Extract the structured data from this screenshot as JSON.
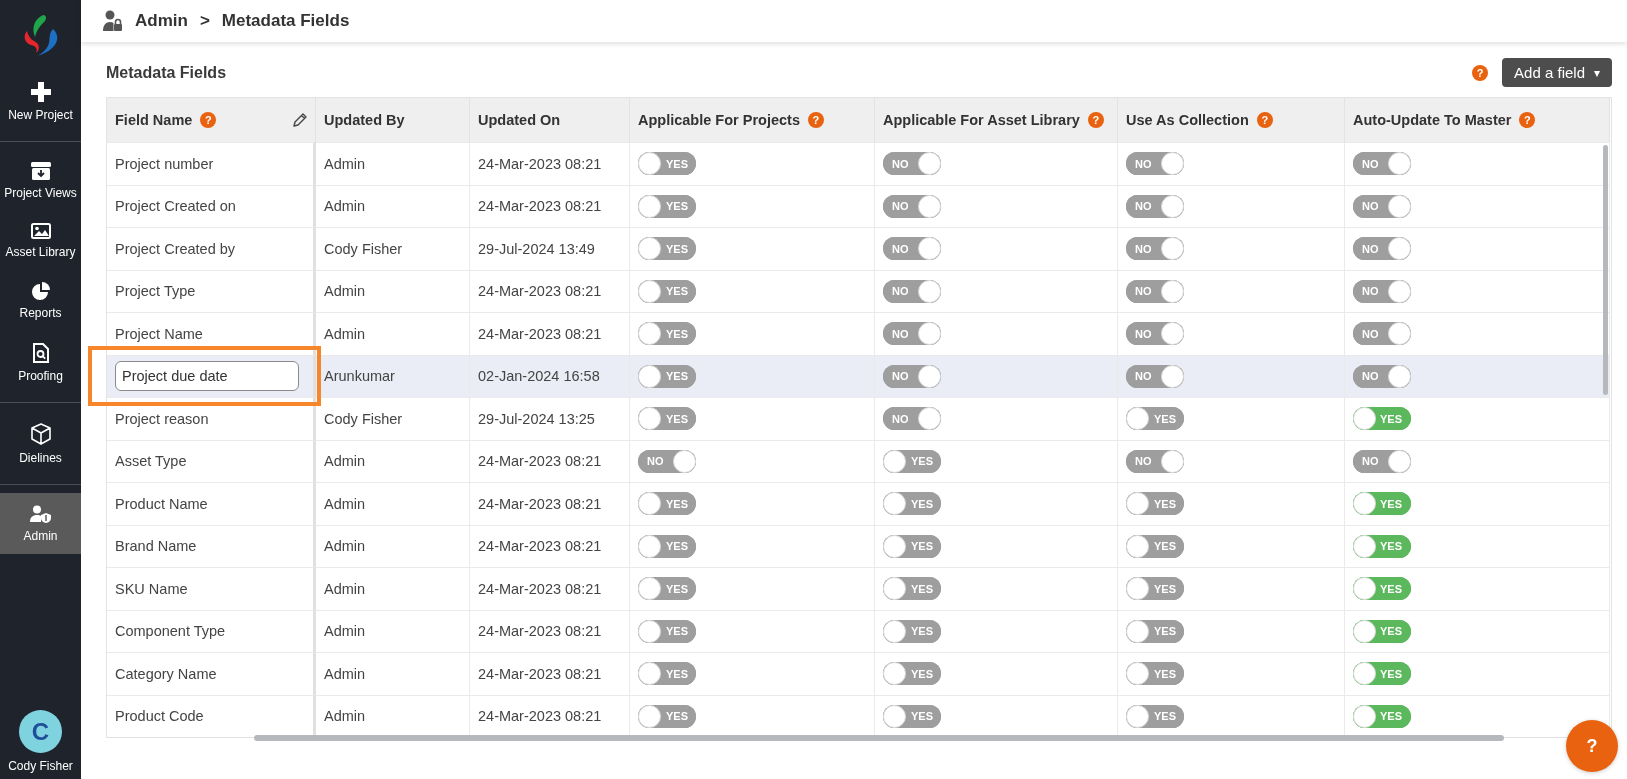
{
  "sidebar": {
    "items": [
      {
        "label": "New Project",
        "selected": false
      },
      {
        "label": "Project Views",
        "selected": false
      },
      {
        "label": "Asset Library",
        "selected": false
      },
      {
        "label": "Reports",
        "selected": false
      },
      {
        "label": "Proofing",
        "selected": false
      },
      {
        "label": "Dielines",
        "selected": false
      },
      {
        "label": "Admin",
        "selected": true
      }
    ],
    "user": {
      "initial": "C",
      "name": "Cody Fisher"
    }
  },
  "header": {
    "breadcrumb": [
      "Admin",
      ">",
      "Metadata Fields"
    ]
  },
  "page": {
    "title": "Metadata Fields",
    "help": "?",
    "add_button": "Add a field",
    "add_caret": "▾"
  },
  "table": {
    "columns": [
      {
        "label": "Field Name",
        "help": "?",
        "edit_icon": true
      },
      {
        "label": "Updated By",
        "edit_icon": false
      },
      {
        "label": "Updated On",
        "edit_icon": false
      },
      {
        "label": "Applicable For Projects",
        "help": "?",
        "edit_icon": false
      },
      {
        "label": "Applicable For Asset Library",
        "help": "?",
        "edit_icon": false
      },
      {
        "label": "Use As Collection",
        "help": "?",
        "edit_icon": false
      },
      {
        "label": "Auto-Update To Master",
        "help": "?",
        "edit_icon": false
      }
    ],
    "rows": [
      {
        "field_name": "Project number",
        "updated_by": "Admin",
        "updated_on": "24-Mar-2023 08:21",
        "selected": false,
        "editing": false,
        "highlighted": false,
        "toggles": [
          {
            "text": "YES",
            "checked": false,
            "active": false
          },
          {
            "text": "NO",
            "checked": true,
            "active": false
          },
          {
            "text": "NO",
            "checked": true,
            "active": false
          },
          {
            "text": "NO",
            "checked": true,
            "active": false
          }
        ]
      },
      {
        "field_name": "Project Created on",
        "updated_by": "Admin",
        "updated_on": "24-Mar-2023 08:21",
        "selected": false,
        "editing": false,
        "highlighted": false,
        "toggles": [
          {
            "text": "YES",
            "checked": false,
            "active": false
          },
          {
            "text": "NO",
            "checked": true,
            "active": false
          },
          {
            "text": "NO",
            "checked": true,
            "active": false
          },
          {
            "text": "NO",
            "checked": true,
            "active": false
          }
        ]
      },
      {
        "field_name": "Project Created by",
        "updated_by": "Cody Fisher",
        "updated_on": "29-Jul-2024 13:49",
        "selected": false,
        "editing": false,
        "highlighted": false,
        "toggles": [
          {
            "text": "YES",
            "checked": false,
            "active": false
          },
          {
            "text": "NO",
            "checked": true,
            "active": false
          },
          {
            "text": "NO",
            "checked": true,
            "active": false
          },
          {
            "text": "NO",
            "checked": true,
            "active": false
          }
        ]
      },
      {
        "field_name": "Project Type",
        "updated_by": "Admin",
        "updated_on": "24-Mar-2023 08:21",
        "selected": false,
        "editing": false,
        "highlighted": false,
        "toggles": [
          {
            "text": "YES",
            "checked": false,
            "active": false
          },
          {
            "text": "NO",
            "checked": true,
            "active": false
          },
          {
            "text": "NO",
            "checked": true,
            "active": false
          },
          {
            "text": "NO",
            "checked": true,
            "active": false
          }
        ]
      },
      {
        "field_name": "Project Name",
        "updated_by": "Admin",
        "updated_on": "24-Mar-2023 08:21",
        "selected": false,
        "editing": false,
        "highlighted": false,
        "toggles": [
          {
            "text": "YES",
            "checked": false,
            "active": false
          },
          {
            "text": "NO",
            "checked": true,
            "active": false
          },
          {
            "text": "NO",
            "checked": true,
            "active": false
          },
          {
            "text": "NO",
            "checked": true,
            "active": false
          }
        ]
      },
      {
        "field_name": "Project due date",
        "updated_by": "Arunkumar",
        "updated_on": "02-Jan-2024 16:58",
        "selected": true,
        "editing": true,
        "highlighted": true,
        "toggles": [
          {
            "text": "YES",
            "checked": false,
            "active": false
          },
          {
            "text": "NO",
            "checked": true,
            "active": false
          },
          {
            "text": "NO",
            "checked": true,
            "active": false
          },
          {
            "text": "NO",
            "checked": true,
            "active": false
          }
        ]
      },
      {
        "field_name": "Project reason",
        "updated_by": "Cody Fisher",
        "updated_on": "29-Jul-2024 13:25",
        "selected": false,
        "editing": false,
        "highlighted": false,
        "toggles": [
          {
            "text": "YES",
            "checked": false,
            "active": false
          },
          {
            "text": "NO",
            "checked": true,
            "active": false
          },
          {
            "text": "YES",
            "checked": false,
            "active": false
          },
          {
            "text": "YES",
            "checked": false,
            "active": true
          }
        ]
      },
      {
        "field_name": "Asset Type",
        "updated_by": "Admin",
        "updated_on": "24-Mar-2023 08:21",
        "selected": false,
        "editing": false,
        "highlighted": false,
        "toggles": [
          {
            "text": "NO",
            "checked": true,
            "active": false
          },
          {
            "text": "YES",
            "checked": false,
            "active": false
          },
          {
            "text": "NO",
            "checked": true,
            "active": false
          },
          {
            "text": "NO",
            "checked": true,
            "active": false
          }
        ]
      },
      {
        "field_name": "Product Name",
        "updated_by": "Admin",
        "updated_on": "24-Mar-2023 08:21",
        "selected": false,
        "editing": false,
        "highlighted": false,
        "toggles": [
          {
            "text": "YES",
            "checked": false,
            "active": false
          },
          {
            "text": "YES",
            "checked": false,
            "active": false
          },
          {
            "text": "YES",
            "checked": false,
            "active": false
          },
          {
            "text": "YES",
            "checked": false,
            "active": true
          }
        ]
      },
      {
        "field_name": "Brand Name",
        "updated_by": "Admin",
        "updated_on": "24-Mar-2023 08:21",
        "selected": false,
        "editing": false,
        "highlighted": false,
        "toggles": [
          {
            "text": "YES",
            "checked": false,
            "active": false
          },
          {
            "text": "YES",
            "checked": false,
            "active": false
          },
          {
            "text": "YES",
            "checked": false,
            "active": false
          },
          {
            "text": "YES",
            "checked": false,
            "active": true
          }
        ]
      },
      {
        "field_name": "SKU Name",
        "updated_by": "Admin",
        "updated_on": "24-Mar-2023 08:21",
        "selected": false,
        "editing": false,
        "highlighted": false,
        "toggles": [
          {
            "text": "YES",
            "checked": false,
            "active": false
          },
          {
            "text": "YES",
            "checked": false,
            "active": false
          },
          {
            "text": "YES",
            "checked": false,
            "active": false
          },
          {
            "text": "YES",
            "checked": false,
            "active": true
          }
        ]
      },
      {
        "field_name": "Component Type",
        "updated_by": "Admin",
        "updated_on": "24-Mar-2023 08:21",
        "selected": false,
        "editing": false,
        "highlighted": false,
        "toggles": [
          {
            "text": "YES",
            "checked": false,
            "active": false
          },
          {
            "text": "YES",
            "checked": false,
            "active": false
          },
          {
            "text": "YES",
            "checked": false,
            "active": false
          },
          {
            "text": "YES",
            "checked": false,
            "active": true
          }
        ]
      },
      {
        "field_name": "Category Name",
        "updated_by": "Admin",
        "updated_on": "24-Mar-2023 08:21",
        "selected": false,
        "editing": false,
        "highlighted": false,
        "toggles": [
          {
            "text": "YES",
            "checked": false,
            "active": false
          },
          {
            "text": "YES",
            "checked": false,
            "active": false
          },
          {
            "text": "YES",
            "checked": false,
            "active": false
          },
          {
            "text": "YES",
            "checked": false,
            "active": true
          }
        ]
      },
      {
        "field_name": "Product Code",
        "updated_by": "Admin",
        "updated_on": "24-Mar-2023 08:21",
        "selected": false,
        "editing": false,
        "highlighted": false,
        "toggles": [
          {
            "text": "YES",
            "checked": false,
            "active": false
          },
          {
            "text": "YES",
            "checked": false,
            "active": false
          },
          {
            "text": "YES",
            "checked": false,
            "active": false
          },
          {
            "text": "YES",
            "checked": false,
            "active": true
          }
        ]
      }
    ]
  },
  "help_fab": "?"
}
